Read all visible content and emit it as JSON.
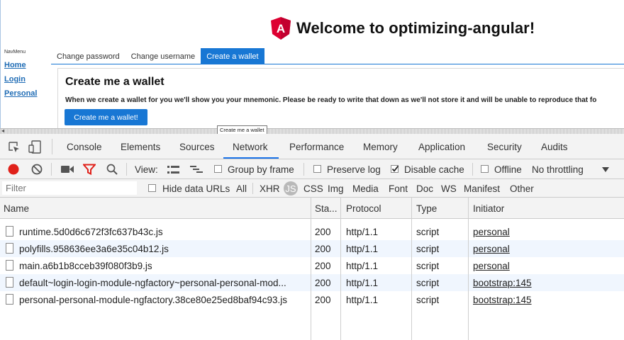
{
  "app": {
    "title": "Welcome to optimizing-angular!",
    "logo_letter": "A",
    "navmenu": {
      "title": "NavMenu",
      "links": [
        "Home",
        "Login",
        "Personal"
      ]
    },
    "tabs": [
      "Change password",
      "Change username",
      "Create a wallet"
    ],
    "active_tab": "Create a wallet",
    "panel": {
      "title": "Create me a wallet",
      "text": "When we create a wallet for you we'll show you your mnemonic. Please be ready to write that down as we'll not store it and will be unable to reproduce that fo",
      "button": "Create me a wallet!"
    },
    "tooltip": "Create me a wallet",
    "brand_color": "#dd0031",
    "accent_color": "#1877d4"
  },
  "devtools": {
    "tabs": [
      "Console",
      "Elements",
      "Sources",
      "Network",
      "Performance",
      "Memory",
      "Application",
      "Security",
      "Audits"
    ],
    "active_tab": "Network",
    "toolbar": {
      "icons": [
        "record-icon",
        "clear-icon",
        "camera-icon",
        "filter-icon",
        "search-icon"
      ],
      "view_label": "View:",
      "group_by_frame": "Group by frame",
      "preserve_log": "Preserve log",
      "disable_cache": "Disable cache",
      "disable_cache_checked": true,
      "offline": "Offline",
      "throttling": "No throttling"
    },
    "filterbar": {
      "placeholder": "Filter",
      "hide_data_urls": "Hide data URLs",
      "types": [
        "All",
        "XHR",
        "JS",
        "CSS",
        "Img",
        "Media",
        "Font",
        "Doc",
        "WS",
        "Manifest",
        "Other"
      ],
      "active_type": "JS"
    },
    "table": {
      "columns": [
        "Name",
        "Sta...",
        "Protocol",
        "Type",
        "Initiator"
      ],
      "rows": [
        {
          "name": "runtime.5d0d6c672f3fc637b43c.js",
          "status": "200",
          "protocol": "http/1.1",
          "type": "script",
          "initiator": "personal"
        },
        {
          "name": "polyfills.958636ee3a6e35c04b12.js",
          "status": "200",
          "protocol": "http/1.1",
          "type": "script",
          "initiator": "personal"
        },
        {
          "name": "main.a6b1b8cceb39f080f3b9.js",
          "status": "200",
          "protocol": "http/1.1",
          "type": "script",
          "initiator": "personal"
        },
        {
          "name": "default~login-login-module-ngfactory~personal-personal-mod...",
          "status": "200",
          "protocol": "http/1.1",
          "type": "script",
          "initiator": "bootstrap:145"
        },
        {
          "name": "personal-personal-module-ngfactory.38ce80e25ed8baf94c93.js",
          "status": "200",
          "protocol": "http/1.1",
          "type": "script",
          "initiator": "bootstrap:145"
        }
      ]
    }
  }
}
